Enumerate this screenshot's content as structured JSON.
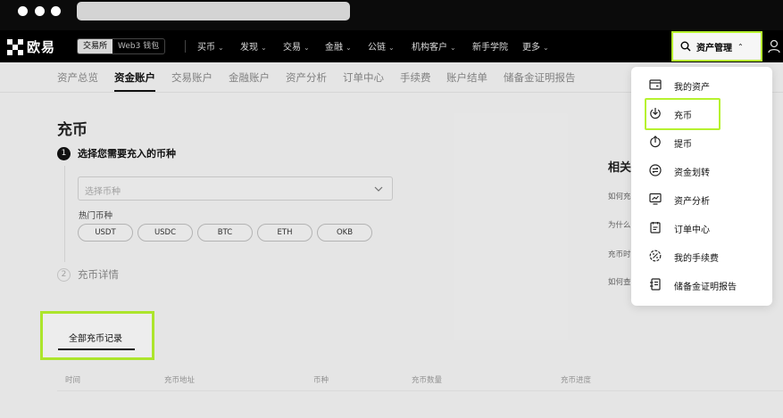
{
  "brand": {
    "name": "欧易"
  },
  "mode_switch": {
    "exchange": "交易所",
    "web3": "Web3 钱包"
  },
  "topnav": {
    "items": [
      "买币",
      "发现",
      "交易",
      "金融",
      "公链",
      "机构客户",
      "新手学院",
      "更多"
    ],
    "asset_management": "资产管理"
  },
  "subnav": {
    "items": [
      "资产总览",
      "资金账户",
      "交易账户",
      "金融账户",
      "资产分析",
      "订单中心",
      "手续费",
      "账户结单",
      "储备金证明报告"
    ],
    "active": "资金账户"
  },
  "main": {
    "title": "充币",
    "step1": {
      "num": "1",
      "label": "选择您需要充入的币种"
    },
    "select_placeholder": "选择币种",
    "hot_label": "热门币种",
    "hot_coins": [
      "USDT",
      "USDC",
      "BTC",
      "ETH",
      "OKB"
    ],
    "step2": {
      "num": "2",
      "label": "充币详情"
    },
    "records_tab": "全部充币记录",
    "table_headers": [
      "时间",
      "充币地址",
      "币种",
      "充币数量",
      "充币进度"
    ]
  },
  "side": {
    "title": "相关",
    "questions": [
      "如何充",
      "为什么",
      "充币时",
      "如何查"
    ]
  },
  "dropdown": {
    "items": [
      {
        "label": "我的资产",
        "icon": "wallet-icon"
      },
      {
        "label": "充币",
        "icon": "deposit-icon"
      },
      {
        "label": "提币",
        "icon": "withdraw-icon"
      },
      {
        "label": "资金划转",
        "icon": "transfer-icon"
      },
      {
        "label": "资产分析",
        "icon": "analysis-icon"
      },
      {
        "label": "订单中心",
        "icon": "order-icon"
      },
      {
        "label": "我的手续费",
        "icon": "fee-icon"
      },
      {
        "label": "储备金证明报告",
        "icon": "report-icon"
      }
    ]
  },
  "colors": {
    "highlight": "#b6f22f",
    "nav_bg": "#000000",
    "page_bg": "#f2f2f2"
  }
}
